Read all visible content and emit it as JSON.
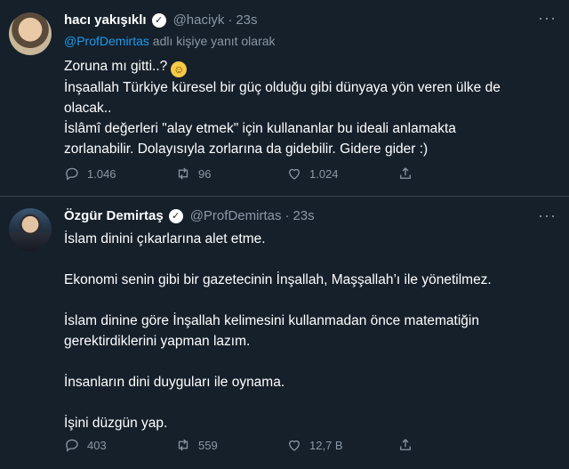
{
  "tweets": [
    {
      "author_name": "hacı yakışıklı",
      "handle": "@haciyk",
      "time": "23s",
      "reply_to_handle": "@ProfDemirtas",
      "reply_suffix": " adlı kişiye yanıt olarak",
      "lines": [
        "Zoruna mı gitti..?",
        "İnşaallah Türkiye küresel bir güç olduğu gibi dünyaya yön veren ülke de",
        "olacak..",
        "İslâmî değerleri \"alay etmek\" için kullananlar bu ideali anlamakta",
        "zorlanabilir. Dolayısıyla zorlarına da gidebilir. Gidere gider  :)"
      ],
      "counts": {
        "replies": "1.046",
        "retweets": "96",
        "likes": "1.024"
      }
    },
    {
      "author_name": "Özgür Demirtaş",
      "handle": "@ProfDemirtas",
      "time": "23s",
      "paragraphs": [
        "İslam dinini çıkarlarına alet etme.",
        "Ekonomi senin gibi bir gazetecinin İnşallah, Maşşallah’ı ile yönetilmez.",
        "İslam dinine göre İnşallah kelimesini kullanmadan önce matematiğin",
        "gerektirdiklerini yapman lazım.",
        "İnsanların dini duyguları ile oynama.",
        "İşini düzgün yap."
      ],
      "counts": {
        "replies": "403",
        "retweets": "559",
        "likes": "12,7 B"
      }
    }
  ],
  "icons": {
    "reply": "speech-bubble-icon",
    "retweet": "retweet-icon",
    "like": "heart-icon",
    "share": "share-icon",
    "more": "more-dots-icon",
    "verified": "verified-badge-icon",
    "emoji": "smiling-face-emoji"
  },
  "colors": {
    "background": "#15202b",
    "secondary_text": "#8b98a5",
    "accent": "#1d9bf0",
    "divider": "#38444d"
  },
  "more_glyph": "···"
}
